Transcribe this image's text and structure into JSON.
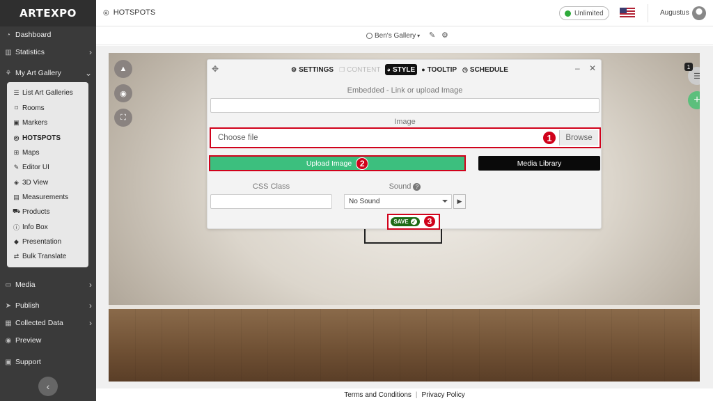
{
  "app": {
    "logo_text": "ARTEXPO"
  },
  "sidebar": {
    "items": [
      {
        "label": "Dashboard",
        "icon": "dashboard-icon"
      },
      {
        "label": "Statistics",
        "icon": "chart-icon"
      },
      {
        "label": "My Art Gallery",
        "icon": "gallery-icon"
      },
      {
        "label": "Media",
        "icon": "monitor-icon"
      },
      {
        "label": "Publish",
        "icon": "send-icon"
      },
      {
        "label": "Collected Data",
        "icon": "table-icon"
      },
      {
        "label": "Preview",
        "icon": "eye-icon"
      },
      {
        "label": "Support",
        "icon": "support-icon"
      }
    ],
    "submenu": [
      {
        "label": "List Art Galleries",
        "icon": "list-icon"
      },
      {
        "label": "Rooms",
        "icon": "room-icon"
      },
      {
        "label": "Markers",
        "icon": "marker-icon"
      },
      {
        "label": "HOTSPOTS",
        "icon": "target-icon"
      },
      {
        "label": "Maps",
        "icon": "map-icon"
      },
      {
        "label": "Editor UI",
        "icon": "editor-icon"
      },
      {
        "label": "3D View",
        "icon": "cube-icon"
      },
      {
        "label": "Measurements",
        "icon": "ruler-icon"
      },
      {
        "label": "Products",
        "icon": "cart-icon"
      },
      {
        "label": "Info Box",
        "icon": "info-icon"
      },
      {
        "label": "Presentation",
        "icon": "presentation-icon"
      },
      {
        "label": "Bulk Translate",
        "icon": "translate-icon"
      }
    ]
  },
  "header": {
    "page_title": "HOTSPOTS",
    "plan": "Unlimited",
    "username": "Augustus"
  },
  "gallery_bar": {
    "gallery_name": "Ben's Gallery"
  },
  "canvas": {
    "hotspot_count": "1"
  },
  "dialog": {
    "tabs": [
      "SETTINGS",
      "CONTENT",
      "STYLE",
      "TOOLTIP",
      "SCHEDULE"
    ],
    "active_tab": "STYLE",
    "embedded_label": "Embedded - Link or upload Image",
    "image_label": "Image",
    "file_placeholder": "Choose file",
    "browse_label": "Browse",
    "upload_label": "Upload Image",
    "media_library_label": "Media Library",
    "css_class_label": "CSS Class",
    "sound_label": "Sound",
    "sound_value": "No Sound",
    "save_label": "SAVE",
    "steps": [
      "1",
      "2",
      "3"
    ]
  },
  "footer": {
    "terms": "Terms and Conditions",
    "privacy": "Privacy Policy"
  },
  "colors": {
    "accent_green": "#3cbf7e",
    "annotation_red": "#d0021b",
    "save_green": "#1e6a16",
    "sidebar_bg": "#3a3a3a"
  }
}
